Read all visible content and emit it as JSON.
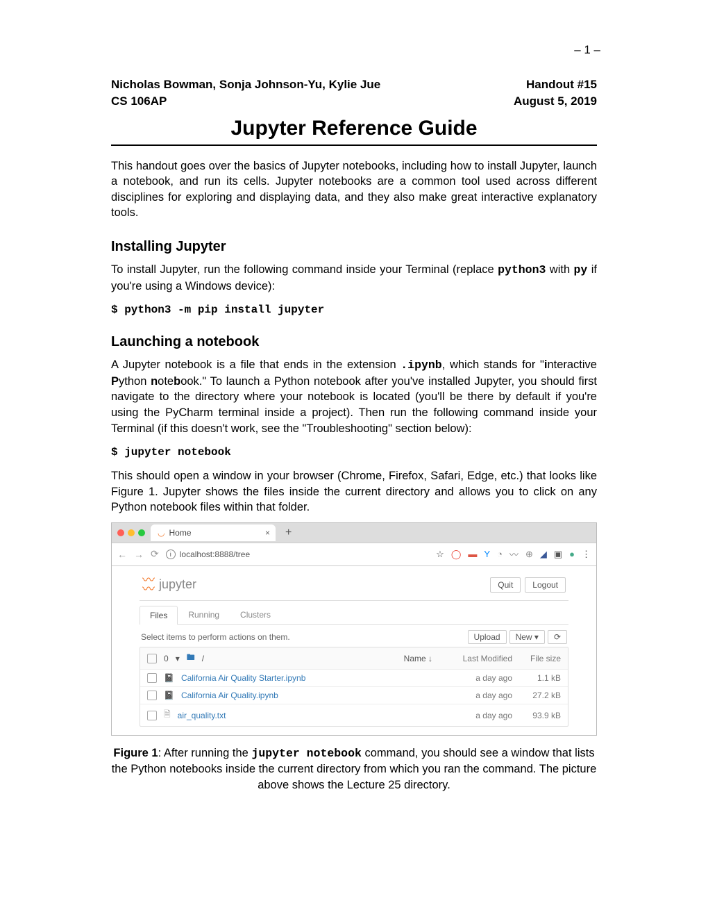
{
  "page_number": "– 1 –",
  "header": {
    "authors": "Nicholas Bowman, Sonja Johnson-Yu, Kylie Jue",
    "course": "CS 106AP",
    "handout": "Handout #15",
    "date": "August 5, 2019"
  },
  "title": "Jupyter Reference Guide",
  "intro": "This handout goes over the basics of Jupyter notebooks, including how to install Jupyter, launch a notebook, and run its cells. Jupyter notebooks are a common tool used across different disciplines for exploring and displaying data, and they also make great interactive explanatory tools.",
  "sections": {
    "install": {
      "heading": "Installing Jupyter",
      "text_pre": "To install Jupyter, run the following command inside your Terminal (replace ",
      "code1": "python3",
      "text_mid": " with ",
      "code2": "py",
      "text_post": " if you're using a Windows device):",
      "command": "$ python3 -m pip install jupyter"
    },
    "launch": {
      "heading": "Launching a notebook",
      "p1_a": "A Jupyter notebook is a file that ends in the extension ",
      "p1_code": ".ipynb",
      "p1_b": ", which stands for \"",
      "p1_i": "i",
      "p1_c": "nteractive ",
      "p1_P": "P",
      "p1_d": "ython ",
      "p1_n": "n",
      "p1_e": "ote",
      "p1_bk": "b",
      "p1_f": "ook.\" To launch a Python notebook after you've installed Jupyter, you should first navigate to the directory where your notebook is located (you'll be there by default if you're using the PyCharm terminal inside a project). Then run the following command inside your Terminal (if this doesn't work, see the \"Troubleshooting\" section below):",
      "command": "$ jupyter notebook",
      "p2": "This should open a window in your browser (Chrome, Firefox, Safari, Edge, etc.) that looks like Figure 1. Jupyter shows the files inside the current directory and allows you to click on any Python notebook files within that folder."
    }
  },
  "figure_caption_a": "Figure 1",
  "figure_caption_b": ": After running the ",
  "figure_caption_code": "jupyter notebook",
  "figure_caption_c": " command, you should see a window that lists the Python notebooks inside the current directory from which you ran the command. The picture above shows the Lecture 25 directory.",
  "browser": {
    "tab_title": "Home",
    "url": "localhost:8888/tree",
    "jupyter_logo_text": "jupyter",
    "quit": "Quit",
    "logout": "Logout",
    "tabs": {
      "files": "Files",
      "running": "Running",
      "clusters": "Clusters"
    },
    "select_items": "Select items to perform actions on them.",
    "upload": "Upload",
    "new": "New ▾",
    "refresh": "⟳",
    "header_row": {
      "count": "0",
      "folder": "▾",
      "slash": "/",
      "name": "Name ↓",
      "mod": "Last Modified",
      "size": "File size"
    },
    "rows": [
      {
        "icon": "nb",
        "name": "California Air Quality Starter.ipynb",
        "mod": "a day ago",
        "size": "1.1 kB"
      },
      {
        "icon": "nb",
        "name": "California Air Quality.ipynb",
        "mod": "a day ago",
        "size": "27.2 kB"
      },
      {
        "icon": "txt",
        "name": "air_quality.txt",
        "mod": "a day ago",
        "size": "93.9 kB"
      }
    ]
  }
}
